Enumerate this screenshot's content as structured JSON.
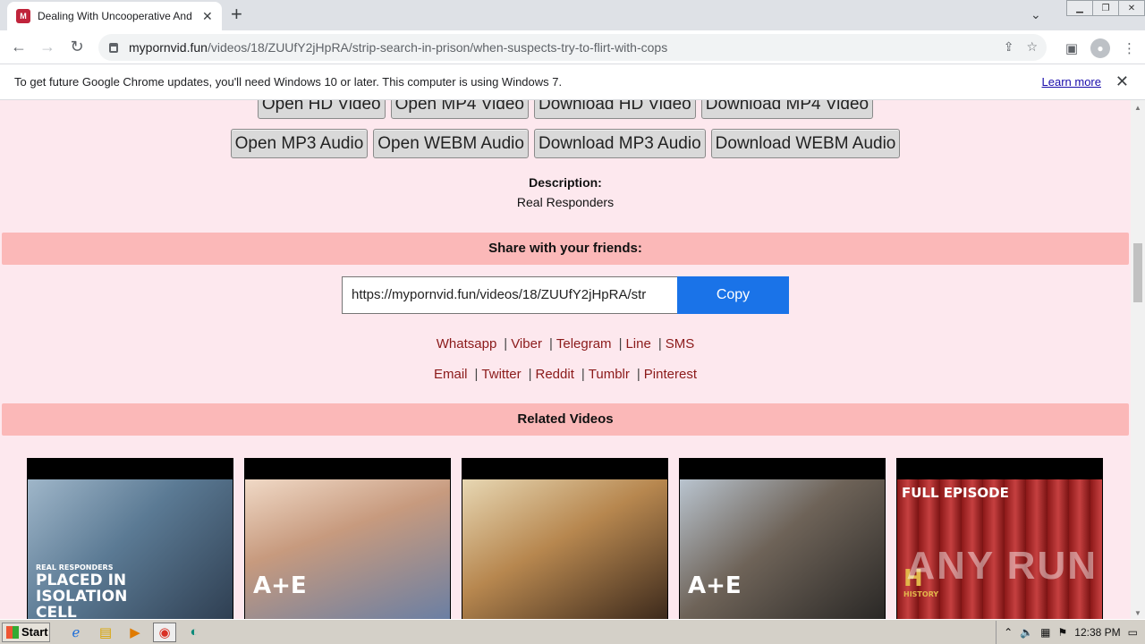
{
  "browser": {
    "tab_title": "Dealing With Uncooperative And Dru",
    "tab_favicon": "M",
    "new_tab": "+",
    "url_host": "mypornvid.fun",
    "url_path": "/videos/18/ZUUfY2jHpRA/strip-search-in-prison/when-suspects-try-to-flirt-with-cops",
    "infobar_text": "To get future Google Chrome updates, you'll need Windows 10 or later. This computer is using Windows 7.",
    "infobar_link": "Learn more"
  },
  "page": {
    "buttons_row1": [
      "Open HD Video",
      "Open MP4 Video",
      "Download HD Video",
      "Download MP4 Video"
    ],
    "buttons_row2": [
      "Open MP3 Audio",
      "Open WEBM Audio",
      "Download MP3 Audio",
      "Download WEBM Audio"
    ],
    "description_label": "Description:",
    "description_text": "Real Responders",
    "share_heading": "Share with your friends:",
    "share_url": "https://mypornvid.fun/videos/18/ZUUfY2jHpRA/str",
    "copy_label": "Copy",
    "links_row1": [
      "Whatsapp",
      "Viber",
      "Telegram",
      "Line",
      "SMS"
    ],
    "links_row2": [
      "Email",
      "Twitter",
      "Reddit",
      "Tumblr",
      "Pinterest"
    ],
    "related_heading": "Related Videos",
    "thumb1_small": "REAL RESPONDERS",
    "thumb1_big": "PLACED IN ISOLATION CELL",
    "thumb2_logo": "A+E",
    "thumb4_logo": "A+E",
    "thumb5_big": "FULL EPISODE",
    "thumb5_logo": "H",
    "thumb5_logo_small": "HISTORY",
    "watermark": "ANY RUN"
  },
  "taskbar": {
    "start_label": "Start",
    "clock": "12:38 PM"
  }
}
